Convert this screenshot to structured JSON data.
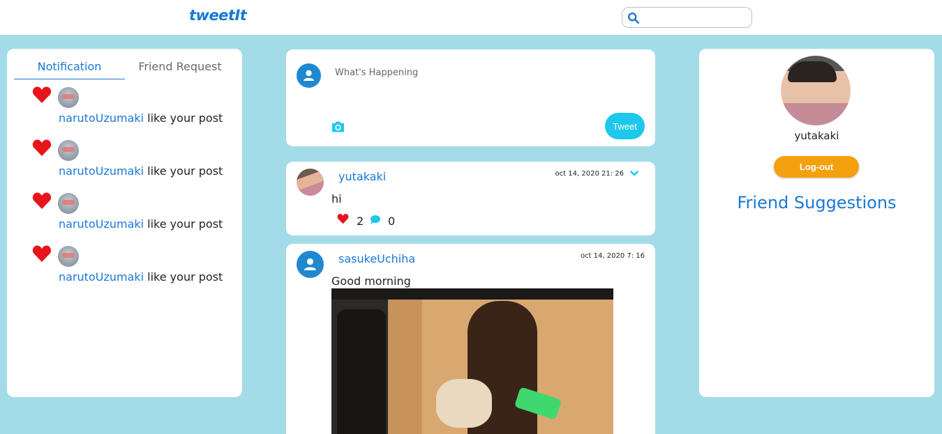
{
  "header": {
    "logo": "tweetIt",
    "search": {
      "placeholder": "",
      "icon": "search-icon"
    }
  },
  "colors": {
    "accent": "#1a77d6",
    "background": "#a3dce8",
    "tweet_button": "#1ec8ec",
    "logout_button": "#f5a00f",
    "like": "#e8141c"
  },
  "left_panel": {
    "tabs": [
      {
        "label": "Notification",
        "active": true
      },
      {
        "label": "Friend Request",
        "active": false
      }
    ],
    "notifications": [
      {
        "user": "narutoUzumaki",
        "text": " like your post"
      },
      {
        "user": "narutoUzumaki",
        "text": " like your post"
      },
      {
        "user": "narutoUzumaki",
        "text": " like your post"
      },
      {
        "user": "narutoUzumaki",
        "text": " like your post"
      }
    ]
  },
  "composer": {
    "placeholder": "What's Happening",
    "tweet_label": "Tweet"
  },
  "posts": [
    {
      "user": "yutakaki",
      "date": "oct 14, 2020 21: 26",
      "text": "hi",
      "likes": "2",
      "comments": "0"
    },
    {
      "user": "sasukeUchiha",
      "date": "oct 14, 2020 7: 16",
      "text": "Good morning"
    }
  ],
  "right_panel": {
    "profile_name": "yutakaki",
    "logout_label": "Log-out",
    "suggestions_title": "Friend Suggestions"
  }
}
